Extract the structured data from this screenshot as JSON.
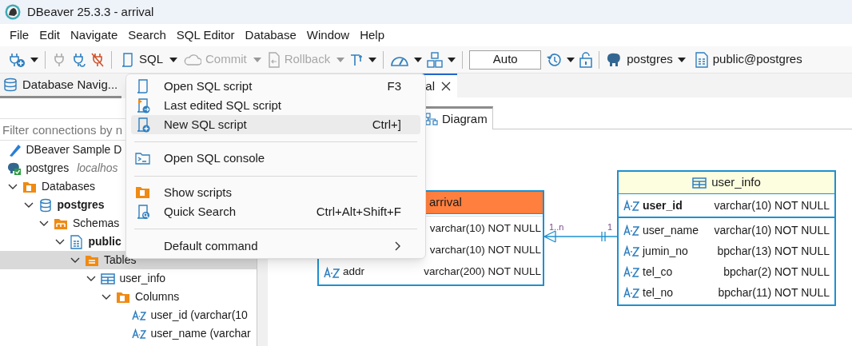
{
  "window": {
    "title": "DBeaver 25.3.3 - arrival"
  },
  "menu_bar": [
    "File",
    "Edit",
    "Navigate",
    "Search",
    "SQL Editor",
    "Database",
    "Window",
    "Help"
  ],
  "toolbar": {
    "sql": "SQL",
    "commit": {
      "label": "Commit",
      "disabled": true
    },
    "rollback": {
      "label": "Rollback",
      "disabled": true
    },
    "transaction_mode": "Auto",
    "datasource": "postgres",
    "schema": "public@postgres"
  },
  "navigator": {
    "tab": "Database Navig...",
    "filter": {
      "placeholder": "Filter connections by n"
    },
    "tree": [
      {
        "kind": "sample",
        "label": "DBeaver Sample D",
        "selected": false
      },
      {
        "kind": "connection",
        "label": "postgres",
        "detail": "localhos",
        "selected": false,
        "children": [
          {
            "kind": "folder",
            "label": "Databases",
            "expanded": true,
            "selected": false,
            "children": [
              {
                "kind": "database",
                "label": "postgres",
                "bold": true,
                "expanded": true,
                "selected": false,
                "children": [
                  {
                    "kind": "schemas",
                    "label": "Schemas",
                    "expanded": true,
                    "selected": false,
                    "children": [
                      {
                        "kind": "schema",
                        "label": "public",
                        "bold": true,
                        "expanded": true,
                        "selected": false,
                        "children": [
                          {
                            "kind": "tables",
                            "label": "Tables",
                            "expanded": true,
                            "selected": true,
                            "children": [
                              {
                                "kind": "table",
                                "label": "user_info",
                                "expanded": true,
                                "selected": false,
                                "children": [
                                  {
                                    "kind": "columns",
                                    "label": "Columns",
                                    "expanded": true,
                                    "selected": false,
                                    "children": [
                                      {
                                        "kind": "column",
                                        "label": "user_id (varchar(10",
                                        "selected": false
                                      },
                                      {
                                        "kind": "column",
                                        "label": "user_name (varchar",
                                        "selected": false
                                      }
                                    ]
                                  }
                                ]
                              }
                            ]
                          }
                        ]
                      }
                    ]
                  }
                ]
              }
            ]
          }
        ]
      }
    ]
  },
  "editor": {
    "tab": "al",
    "subtabs": [
      {
        "label": "Diagram",
        "selected": true
      }
    ],
    "entities": [
      {
        "name": "arrival",
        "color": "#ff7f3f",
        "columns": [
          {
            "type": "varchar(10) NOT NULL",
            "key": false
          },
          {
            "type": "varchar(10) NOT NULL",
            "key": false
          },
          {
            "name": "addr",
            "type": "varchar(200) NOT NULL",
            "key": false
          }
        ]
      },
      {
        "name": "user_info",
        "color": "#fdfde0",
        "columns": [
          {
            "name": "user_id",
            "type": "varchar(10) NOT NULL",
            "key": true
          },
          {
            "name": "user_name",
            "type": "varchar(10) NOT NULL",
            "key": false
          },
          {
            "name": "jumin_no",
            "type": "bpchar(13) NOT NULL",
            "key": false
          },
          {
            "name": "tel_co",
            "type": "bpchar(2) NOT NULL",
            "key": false
          },
          {
            "name": "tel_no",
            "type": "bpchar(11) NOT NULL",
            "key": false
          }
        ]
      }
    ],
    "relation": {
      "from_label": "1..n",
      "to_label": "1"
    }
  },
  "dropdown_menu": [
    {
      "kind": "item",
      "label": "Open SQL script",
      "shortcut": "F3",
      "selected": false
    },
    {
      "kind": "item",
      "label": "Last edited SQL script",
      "selected": false
    },
    {
      "kind": "item",
      "label": "New SQL script",
      "shortcut": "Ctrl+]",
      "selected": true
    },
    {
      "kind": "separator"
    },
    {
      "kind": "item",
      "label": "Open SQL console",
      "selected": false
    },
    {
      "kind": "separator"
    },
    {
      "kind": "item",
      "label": "Show scripts",
      "selected": false
    },
    {
      "kind": "item",
      "label": "Quick Search",
      "shortcut": "Ctrl+Alt+Shift+F",
      "selected": false
    },
    {
      "kind": "separator"
    },
    {
      "kind": "item",
      "label": "Default command",
      "submenu": true,
      "selected": false
    }
  ]
}
